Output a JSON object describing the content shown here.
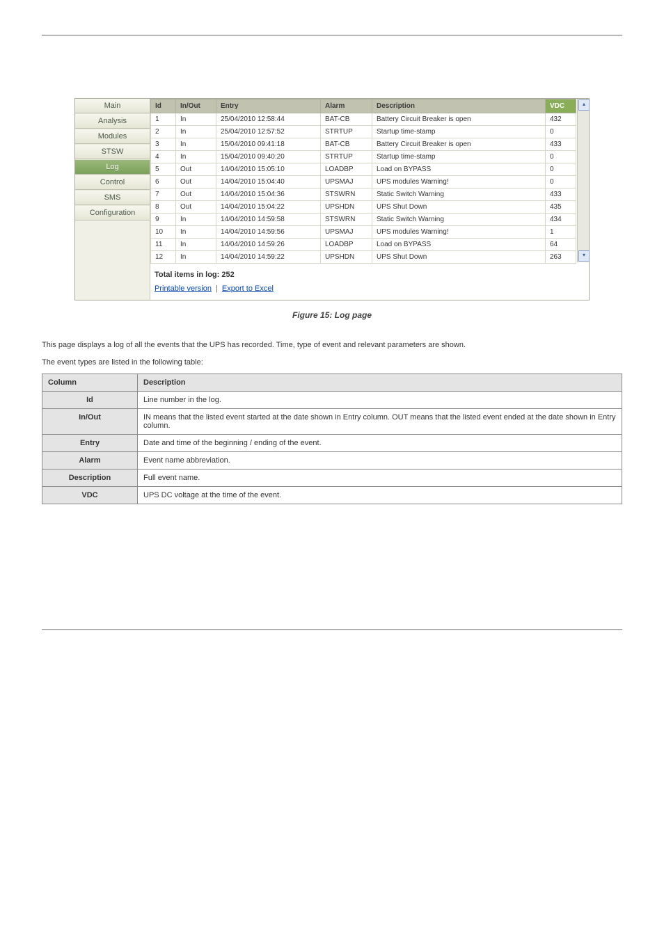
{
  "sidebar": {
    "items": [
      {
        "label": "Main"
      },
      {
        "label": "Analysis"
      },
      {
        "label": "Modules"
      },
      {
        "label": "STSW"
      },
      {
        "label": "Log",
        "active": true
      },
      {
        "label": "Control"
      },
      {
        "label": "SMS"
      },
      {
        "label": "Configuration"
      }
    ]
  },
  "logtable": {
    "headers": {
      "id": "Id",
      "inout": "In/Out",
      "entry": "Entry",
      "alarm": "Alarm",
      "description": "Description",
      "vdc": "VDC"
    },
    "rows": [
      {
        "id": "1",
        "inout": "In",
        "entry": "25/04/2010 12:58:44",
        "alarm": "BAT-CB",
        "description": "Battery Circuit Breaker is open",
        "vdc": "432"
      },
      {
        "id": "2",
        "inout": "In",
        "entry": "25/04/2010 12:57:52",
        "alarm": "STRTUP",
        "description": "Startup time-stamp",
        "vdc": "0"
      },
      {
        "id": "3",
        "inout": "In",
        "entry": "15/04/2010 09:41:18",
        "alarm": "BAT-CB",
        "description": "Battery Circuit Breaker is open",
        "vdc": "433"
      },
      {
        "id": "4",
        "inout": "In",
        "entry": "15/04/2010 09:40:20",
        "alarm": "STRTUP",
        "description": "Startup time-stamp",
        "vdc": "0"
      },
      {
        "id": "5",
        "inout": "Out",
        "entry": "14/04/2010 15:05:10",
        "alarm": "LOADBP",
        "description": "Load on BYPASS",
        "vdc": "0"
      },
      {
        "id": "6",
        "inout": "Out",
        "entry": "14/04/2010 15:04:40",
        "alarm": "UPSMAJ",
        "description": "UPS modules Warning!",
        "vdc": "0"
      },
      {
        "id": "7",
        "inout": "Out",
        "entry": "14/04/2010 15:04:36",
        "alarm": "STSWRN",
        "description": "Static Switch Warning",
        "vdc": "433"
      },
      {
        "id": "8",
        "inout": "Out",
        "entry": "14/04/2010 15:04:22",
        "alarm": "UPSHDN",
        "description": "UPS Shut Down",
        "vdc": "435"
      },
      {
        "id": "9",
        "inout": "In",
        "entry": "14/04/2010 14:59:58",
        "alarm": "STSWRN",
        "description": "Static Switch Warning",
        "vdc": "434"
      },
      {
        "id": "10",
        "inout": "In",
        "entry": "14/04/2010 14:59:56",
        "alarm": "UPSMAJ",
        "description": "UPS modules Warning!",
        "vdc": "1"
      },
      {
        "id": "11",
        "inout": "In",
        "entry": "14/04/2010 14:59:26",
        "alarm": "LOADBP",
        "description": "Load on BYPASS",
        "vdc": "64"
      },
      {
        "id": "12",
        "inout": "In",
        "entry": "14/04/2010 14:59:22",
        "alarm": "UPSHDN",
        "description": "UPS Shut Down",
        "vdc": "263"
      }
    ]
  },
  "footer": {
    "total_label": "Total items in log: 252",
    "printable_label": "Printable version",
    "export_label": "Export to Excel"
  },
  "caption": "Figure 15: Log page",
  "body": {
    "p1": "This page displays a log of all the events that the UPS has recorded. Time, type of event and relevant parameters are shown.",
    "p2": "The event types are listed in the following table:"
  },
  "fields_table": {
    "headers": {
      "col": "Column",
      "desc": "Description"
    },
    "rows": [
      {
        "k": "Id",
        "d": "Line number in the log."
      },
      {
        "k": "In/Out",
        "d": "IN means that the listed event started at the date shown in Entry column. OUT means that the listed event ended at the date shown in Entry column."
      },
      {
        "k": "Entry",
        "d": "Date and time of the beginning / ending of the event."
      },
      {
        "k": "Alarm",
        "d": "Event name abbreviation."
      },
      {
        "k": "Description",
        "d": "Full event name."
      },
      {
        "k": "VDC",
        "d": "UPS DC voltage at the time of the event."
      }
    ]
  }
}
